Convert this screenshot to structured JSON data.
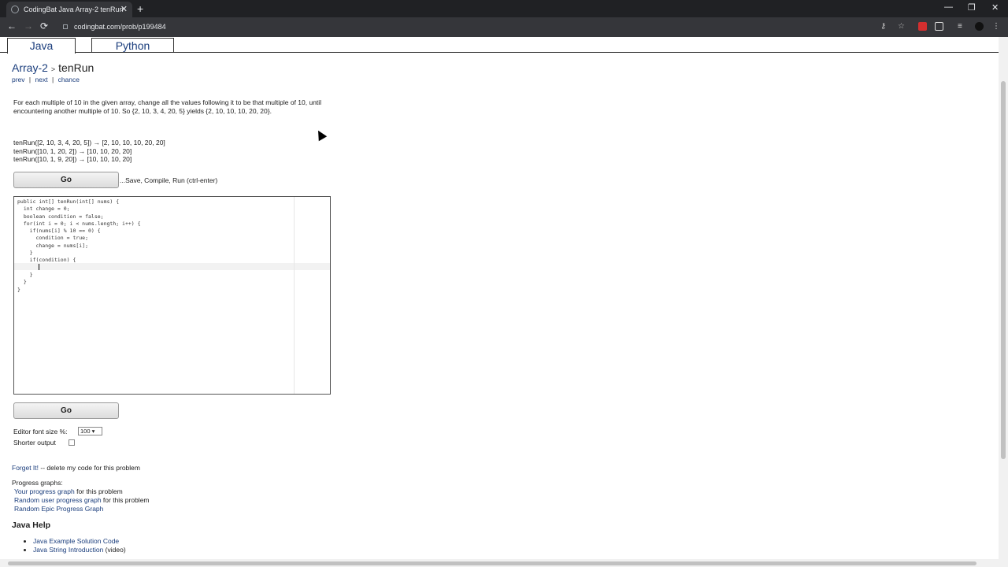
{
  "browser": {
    "tab_title": "CodingBat Java Array-2 tenRun",
    "tab_close": "✕",
    "new_tab": "+",
    "url": "codingbat.com/prob/p199484",
    "window_controls": [
      "—",
      "❐",
      "✕"
    ],
    "nav": {
      "back": "←",
      "forward": "→",
      "reload": "⟳"
    },
    "extensions": [
      "key-icon",
      "star-icon",
      "adblock-icon",
      "extension-icon",
      "playlist-icon",
      "profile-icon"
    ]
  },
  "page": {
    "lang_tabs": [
      "Java",
      "Python"
    ],
    "breadcrumb": {
      "section": "Array-2",
      "separator": ">",
      "problem": "tenRun"
    },
    "subnav": {
      "prev": "prev",
      "next": "next",
      "chance": "chance",
      "divider": "|"
    },
    "description": "For each multiple of 10 in the given array, change all the values following it to be that multiple of 10, until encountering another multiple of 10. So {2, 10, 3, 4, 20, 5} yields {2, 10, 10, 10, 20, 20}.",
    "examples": [
      "tenRun([2, 10, 3, 4, 20, 5]) → [2, 10, 10, 10, 20, 20]",
      "tenRun([10, 1, 20, 2]) → [10, 10, 20, 20]",
      "tenRun([10, 1, 9, 20]) → [10, 10, 10, 20]"
    ],
    "go_label": "Go",
    "go_hint": "...Save, Compile, Run (ctrl-enter)",
    "code": "public int[] tenRun(int[] nums) {\n  int change = 0;\n  boolean condition = false;\n  for(int i = 0; i < nums.length; i++) {\n    if(nums[i] % 10 == 0) {\n      condition = true;\n      change = nums[i];\n    }\n    if(condition) {\n      \n    }\n  }\n}",
    "font_size_label": "Editor font size %:",
    "font_size_value": "100 ▾",
    "shorter_output_label": "Shorter output",
    "forget_link": "Forget It!",
    "forget_rest": " -- delete my code for this problem",
    "progress_heading": "Progress graphs:",
    "progress_links": [
      {
        "link": "Your progress graph",
        "rest": " for this problem"
      },
      {
        "link": "Random user progress graph",
        "rest": " for this problem"
      },
      {
        "link": "Random Epic Progress Graph",
        "rest": ""
      }
    ],
    "java_help_heading": "Java Help",
    "java_help_items": [
      {
        "link": "Java Example Solution Code",
        "rest": ""
      },
      {
        "link": "Java String Introduction",
        "rest": " (video)"
      }
    ]
  }
}
